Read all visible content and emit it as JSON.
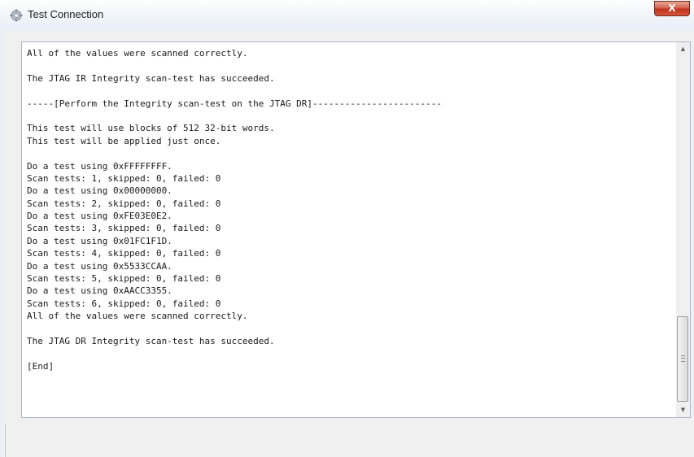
{
  "window": {
    "title": "Test Connection",
    "close_label": "X"
  },
  "icons": {
    "app": "gear-icon",
    "close": "close-icon",
    "scroll_up": "scroll-up-arrow-icon",
    "scroll_down": "scroll-down-arrow-icon"
  },
  "log": {
    "lines": [
      "All of the values were scanned correctly.",
      "",
      "The JTAG IR Integrity scan-test has succeeded.",
      "",
      "-----[Perform the Integrity scan-test on the JTAG DR]------------------------",
      "",
      "This test will use blocks of 512 32-bit words.",
      "This test will be applied just once.",
      "",
      "Do a test using 0xFFFFFFFF.",
      "Scan tests: 1, skipped: 0, failed: 0",
      "Do a test using 0x00000000.",
      "Scan tests: 2, skipped: 0, failed: 0",
      "Do a test using 0xFE03E0E2.",
      "Scan tests: 3, skipped: 0, failed: 0",
      "Do a test using 0x01FC1F1D.",
      "Scan tests: 4, skipped: 0, failed: 0",
      "Do a test using 0x5533CCAA.",
      "Scan tests: 5, skipped: 0, failed: 0",
      "Do a test using 0xAACC3355.",
      "Scan tests: 6, skipped: 0, failed: 0",
      "All of the values were scanned correctly.",
      "",
      "The JTAG DR Integrity scan-test has succeeded.",
      "",
      "[End]"
    ]
  },
  "scrollbar": {
    "position": 0.9
  },
  "colors": {
    "close_button": "#c7402a",
    "frame_border": "#abb7c6"
  }
}
